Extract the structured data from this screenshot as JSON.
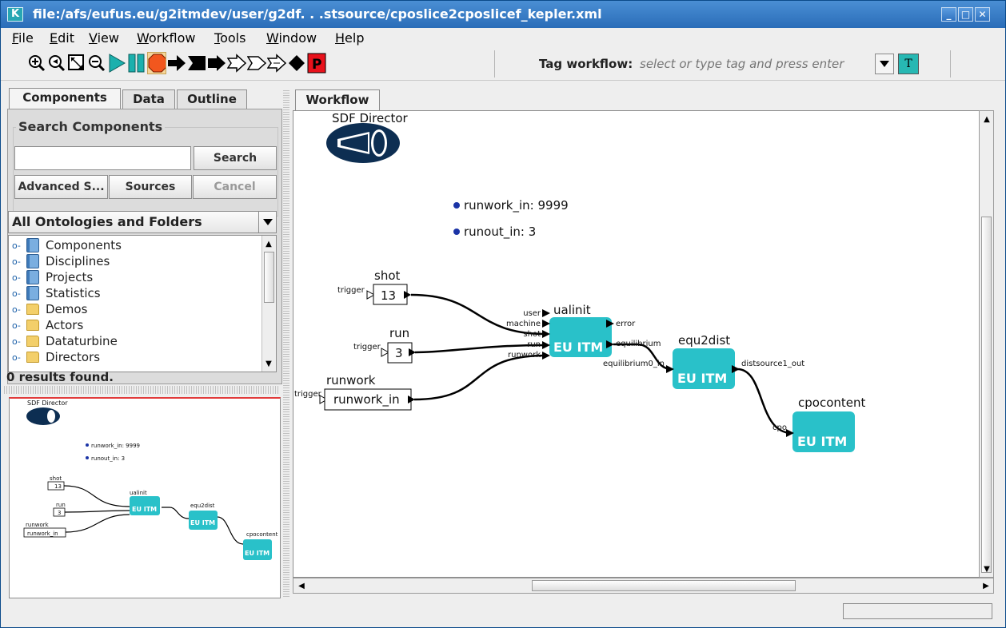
{
  "window": {
    "title": "file:/afs/eufus.eu/g2itmdev/user/g2df. . .stsource/cposlice2cposlicef_kepler.xml",
    "app_icon": "K"
  },
  "menu": [
    "File",
    "Edit",
    "View",
    "Workflow",
    "Tools",
    "Window",
    "Help"
  ],
  "toolbar": {
    "buttons": [
      "zoom-in-icon",
      "zoom-reset-icon",
      "zoom-fit-icon",
      "zoom-out-icon",
      "run-icon",
      "pause-icon",
      "stop-icon",
      "arrow-right-icon",
      "flag-icon",
      "arrow-right-icon",
      "hollow-arrow-icon",
      "hollow-arrow-icon",
      "hollow-arrow-icon",
      "diamond-icon",
      "p-icon"
    ],
    "tag_label": "Tag workflow:",
    "tag_placeholder": "select or type tag and press enter",
    "tag_button": "T"
  },
  "left": {
    "tabs": [
      "Components",
      "Data",
      "Outline"
    ],
    "search_title": "Search Components",
    "search_button": "Search",
    "advanced_button": "Advanced S...",
    "sources_button": "Sources",
    "cancel_button": "Cancel",
    "ontology": "All Ontologies and Folders",
    "tree": [
      {
        "label": "Components",
        "icon": "book-icon"
      },
      {
        "label": "Disciplines",
        "icon": "book-icon"
      },
      {
        "label": "Projects",
        "icon": "book-icon"
      },
      {
        "label": "Statistics",
        "icon": "book-icon"
      },
      {
        "label": "Demos",
        "icon": "folder-icon"
      },
      {
        "label": "Actors",
        "icon": "folder-icon"
      },
      {
        "label": "Dataturbine",
        "icon": "folder-icon"
      },
      {
        "label": "Directors",
        "icon": "folder-icon"
      }
    ],
    "results": "0 results found."
  },
  "workflow": {
    "tab": "Workflow",
    "director": "SDF Director",
    "params": [
      {
        "label": "runwork_in: 9999"
      },
      {
        "label": "runout_in: 3"
      }
    ],
    "sources": [
      {
        "title": "shot",
        "value": "13",
        "port": "trigger"
      },
      {
        "title": "run",
        "value": "3",
        "port": "trigger"
      },
      {
        "title": "runwork",
        "value": "runwork_in",
        "port": "trigger"
      }
    ],
    "actors": [
      {
        "title": "ualinit",
        "label": "EU ITM",
        "inputs": [
          "user",
          "machine",
          "shot",
          "run",
          "runwork"
        ],
        "outputs": [
          "error",
          "equilibrium"
        ]
      },
      {
        "title": "equ2dist",
        "label": "EU ITM",
        "inputs": [
          "equilibrium0_in"
        ],
        "outputs": [
          "distsource1_out"
        ]
      },
      {
        "title": "cpocontent",
        "label": "EU ITM",
        "inputs": [
          "cpo"
        ],
        "outputs": []
      }
    ]
  },
  "colors": {
    "actor": "#29c1c9",
    "director": "#0d2e52",
    "titlebar": "#2f72c0",
    "stop": "#f2571e",
    "play": "#1bb0ad"
  }
}
